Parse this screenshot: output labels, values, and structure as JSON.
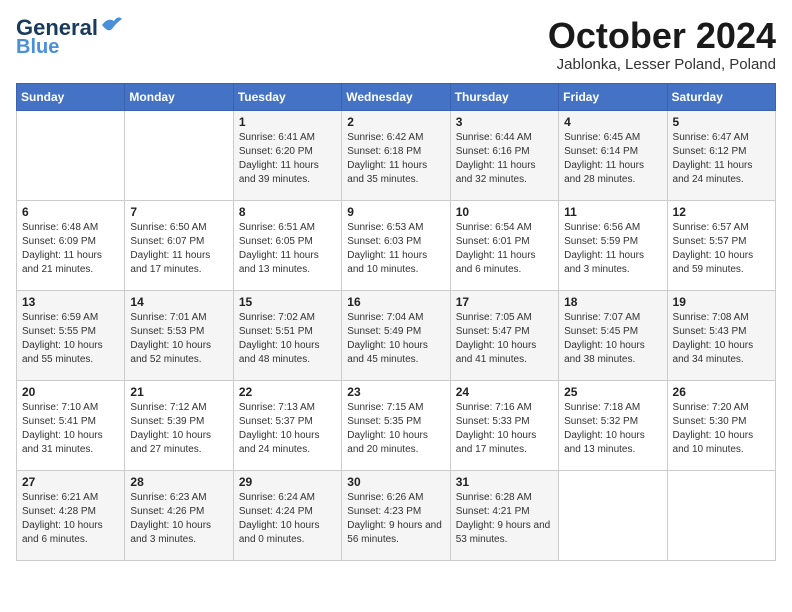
{
  "logo": {
    "line1": "General",
    "line2": "Blue"
  },
  "title": "October 2024",
  "location": "Jablonka, Lesser Poland, Poland",
  "days_of_week": [
    "Sunday",
    "Monday",
    "Tuesday",
    "Wednesday",
    "Thursday",
    "Friday",
    "Saturday"
  ],
  "weeks": [
    [
      {
        "num": "",
        "detail": ""
      },
      {
        "num": "",
        "detail": ""
      },
      {
        "num": "1",
        "detail": "Sunrise: 6:41 AM\nSunset: 6:20 PM\nDaylight: 11 hours and 39 minutes."
      },
      {
        "num": "2",
        "detail": "Sunrise: 6:42 AM\nSunset: 6:18 PM\nDaylight: 11 hours and 35 minutes."
      },
      {
        "num": "3",
        "detail": "Sunrise: 6:44 AM\nSunset: 6:16 PM\nDaylight: 11 hours and 32 minutes."
      },
      {
        "num": "4",
        "detail": "Sunrise: 6:45 AM\nSunset: 6:14 PM\nDaylight: 11 hours and 28 minutes."
      },
      {
        "num": "5",
        "detail": "Sunrise: 6:47 AM\nSunset: 6:12 PM\nDaylight: 11 hours and 24 minutes."
      }
    ],
    [
      {
        "num": "6",
        "detail": "Sunrise: 6:48 AM\nSunset: 6:09 PM\nDaylight: 11 hours and 21 minutes."
      },
      {
        "num": "7",
        "detail": "Sunrise: 6:50 AM\nSunset: 6:07 PM\nDaylight: 11 hours and 17 minutes."
      },
      {
        "num": "8",
        "detail": "Sunrise: 6:51 AM\nSunset: 6:05 PM\nDaylight: 11 hours and 13 minutes."
      },
      {
        "num": "9",
        "detail": "Sunrise: 6:53 AM\nSunset: 6:03 PM\nDaylight: 11 hours and 10 minutes."
      },
      {
        "num": "10",
        "detail": "Sunrise: 6:54 AM\nSunset: 6:01 PM\nDaylight: 11 hours and 6 minutes."
      },
      {
        "num": "11",
        "detail": "Sunrise: 6:56 AM\nSunset: 5:59 PM\nDaylight: 11 hours and 3 minutes."
      },
      {
        "num": "12",
        "detail": "Sunrise: 6:57 AM\nSunset: 5:57 PM\nDaylight: 10 hours and 59 minutes."
      }
    ],
    [
      {
        "num": "13",
        "detail": "Sunrise: 6:59 AM\nSunset: 5:55 PM\nDaylight: 10 hours and 55 minutes."
      },
      {
        "num": "14",
        "detail": "Sunrise: 7:01 AM\nSunset: 5:53 PM\nDaylight: 10 hours and 52 minutes."
      },
      {
        "num": "15",
        "detail": "Sunrise: 7:02 AM\nSunset: 5:51 PM\nDaylight: 10 hours and 48 minutes."
      },
      {
        "num": "16",
        "detail": "Sunrise: 7:04 AM\nSunset: 5:49 PM\nDaylight: 10 hours and 45 minutes."
      },
      {
        "num": "17",
        "detail": "Sunrise: 7:05 AM\nSunset: 5:47 PM\nDaylight: 10 hours and 41 minutes."
      },
      {
        "num": "18",
        "detail": "Sunrise: 7:07 AM\nSunset: 5:45 PM\nDaylight: 10 hours and 38 minutes."
      },
      {
        "num": "19",
        "detail": "Sunrise: 7:08 AM\nSunset: 5:43 PM\nDaylight: 10 hours and 34 minutes."
      }
    ],
    [
      {
        "num": "20",
        "detail": "Sunrise: 7:10 AM\nSunset: 5:41 PM\nDaylight: 10 hours and 31 minutes."
      },
      {
        "num": "21",
        "detail": "Sunrise: 7:12 AM\nSunset: 5:39 PM\nDaylight: 10 hours and 27 minutes."
      },
      {
        "num": "22",
        "detail": "Sunrise: 7:13 AM\nSunset: 5:37 PM\nDaylight: 10 hours and 24 minutes."
      },
      {
        "num": "23",
        "detail": "Sunrise: 7:15 AM\nSunset: 5:35 PM\nDaylight: 10 hours and 20 minutes."
      },
      {
        "num": "24",
        "detail": "Sunrise: 7:16 AM\nSunset: 5:33 PM\nDaylight: 10 hours and 17 minutes."
      },
      {
        "num": "25",
        "detail": "Sunrise: 7:18 AM\nSunset: 5:32 PM\nDaylight: 10 hours and 13 minutes."
      },
      {
        "num": "26",
        "detail": "Sunrise: 7:20 AM\nSunset: 5:30 PM\nDaylight: 10 hours and 10 minutes."
      }
    ],
    [
      {
        "num": "27",
        "detail": "Sunrise: 6:21 AM\nSunset: 4:28 PM\nDaylight: 10 hours and 6 minutes."
      },
      {
        "num": "28",
        "detail": "Sunrise: 6:23 AM\nSunset: 4:26 PM\nDaylight: 10 hours and 3 minutes."
      },
      {
        "num": "29",
        "detail": "Sunrise: 6:24 AM\nSunset: 4:24 PM\nDaylight: 10 hours and 0 minutes."
      },
      {
        "num": "30",
        "detail": "Sunrise: 6:26 AM\nSunset: 4:23 PM\nDaylight: 9 hours and 56 minutes."
      },
      {
        "num": "31",
        "detail": "Sunrise: 6:28 AM\nSunset: 4:21 PM\nDaylight: 9 hours and 53 minutes."
      },
      {
        "num": "",
        "detail": ""
      },
      {
        "num": "",
        "detail": ""
      }
    ]
  ]
}
